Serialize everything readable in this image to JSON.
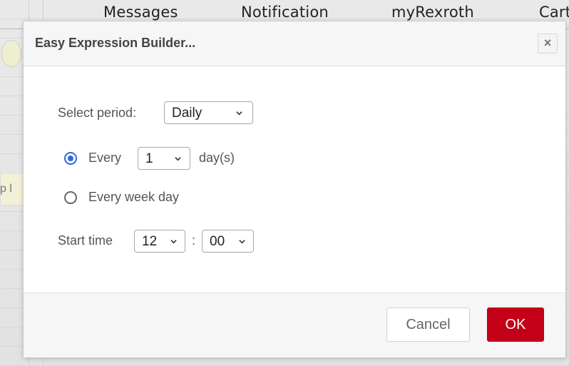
{
  "top_nav": {
    "messages": "Messages",
    "notification": "Notification",
    "myrexroth": "myRexroth",
    "cart": "Cart"
  },
  "background": {
    "partial_text": "p l"
  },
  "dialog": {
    "title": "Easy Expression Builder...",
    "close_icon": "×",
    "period_label": "Select period:",
    "period_value": "Daily",
    "every_label": "Every",
    "every_value": "1",
    "days_suffix": "day(s)",
    "every_week_day_label": "Every week day",
    "start_time_label": "Start time",
    "hour_value": "12",
    "time_separator": ":",
    "minute_value": "00",
    "selected_option": "every",
    "cancel_label": "Cancel",
    "ok_label": "OK"
  },
  "colors": {
    "ok_button": "#c40018",
    "radio_accent": "#2f6bd8"
  }
}
